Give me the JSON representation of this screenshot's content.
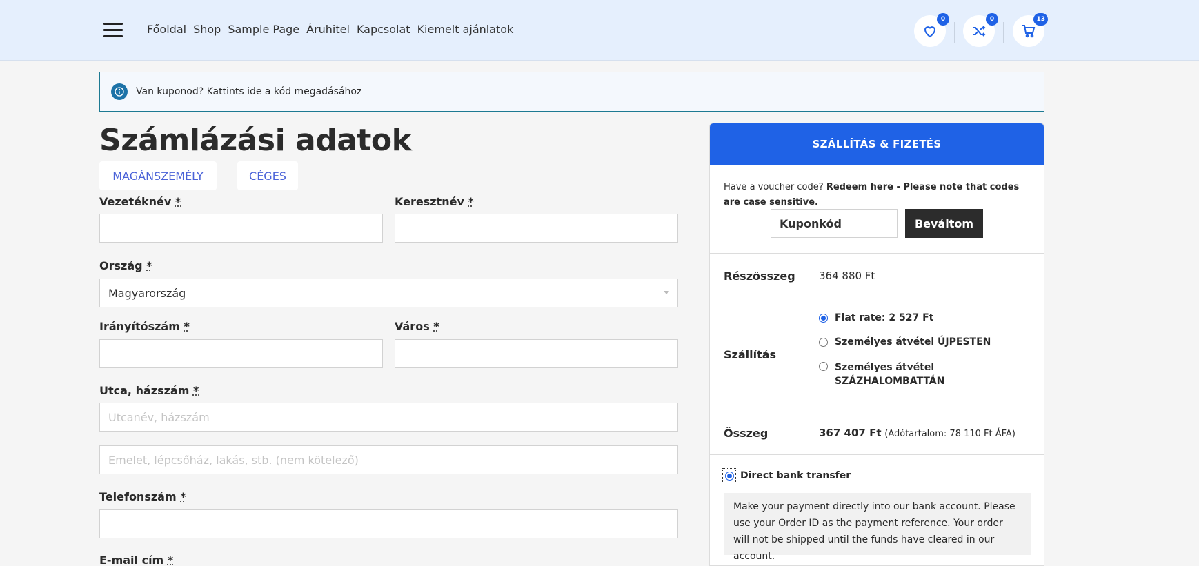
{
  "header": {
    "nav": [
      "Főoldal",
      "Shop",
      "Sample Page",
      "Áruhitel",
      "Kapcsolat",
      "Kiemelt ajánlatok"
    ],
    "wishlist_count": "0",
    "compare_count": "0",
    "cart_count": "13"
  },
  "notice": {
    "text": "Van kuponod? Kattints ide a kód megadásához"
  },
  "billing": {
    "title": "Számlázási adatok",
    "tabs": [
      "MAGÁNSZEMÉLY",
      "CÉGES"
    ],
    "fields": {
      "last_name": "Vezetéknév",
      "first_name": "Keresztnév",
      "country": "Ország",
      "country_value": "Magyarország",
      "zip": "Irányítószám",
      "city": "Város",
      "street": "Utca, házszám",
      "street_placeholder": "Utcanév, házszám",
      "street2_placeholder": "Emelet, lépcsőház, lakás, stb. (nem kötelező)",
      "phone": "Telefonszám",
      "email": "E-mail cím",
      "required": "*"
    }
  },
  "order": {
    "heading": "SZÁLLÍTÁS & FIZETÉS",
    "voucher_prefix": "Have a voucher code?",
    "voucher_bold": "Redeem here - Please note that codes are case sensitive.",
    "coupon_value": "Kuponkód",
    "redeem_button": "Beváltom",
    "subtotal_label": "Részösszeg",
    "subtotal_value": "364 880 Ft",
    "shipping_label": "Szállítás",
    "shipping_options": [
      "Flat rate: 2 527 Ft",
      "Személyes átvétel ÚJPESTEN",
      "Személyes átvétel SZÁZHALOMBATTÁN"
    ],
    "total_label": "Összeg",
    "total_value": "367 407 Ft",
    "total_tax": "(Adótartalom: 78 110 Ft ÁFA)",
    "payment_label": "Direct bank transfer",
    "payment_desc": "Make your payment directly into our bank account. Please use your Order ID as the payment reference. Your order will not be shipped until the funds have cleared in our account."
  },
  "colors": {
    "accent": "#1f62e6",
    "header_bg": "#e5effd",
    "dark_button": "#2c2c2c"
  }
}
